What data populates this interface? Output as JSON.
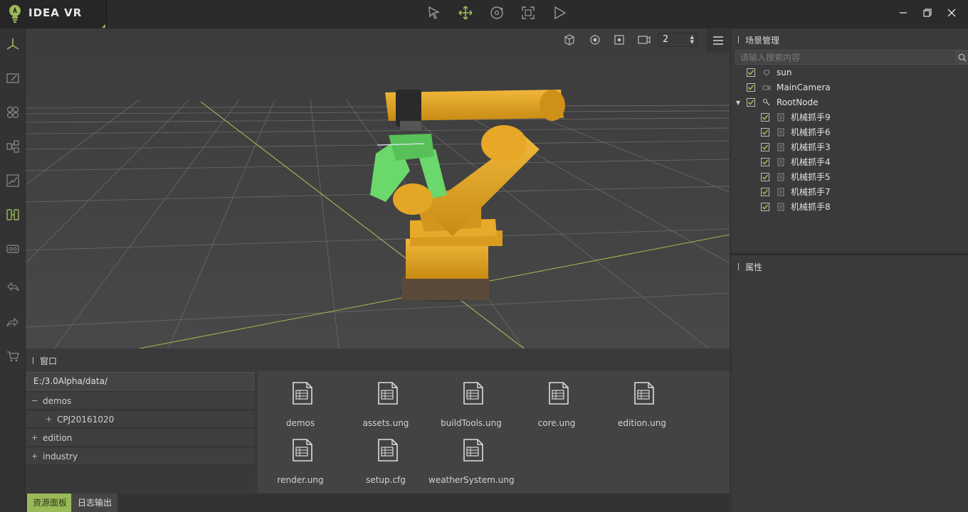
{
  "app": {
    "title": "IDEA VR"
  },
  "viewport": {
    "camera_index": "2"
  },
  "scene": {
    "title": "场景管理",
    "search_placeholder": "请输入搜索内容",
    "nodes": [
      {
        "label": "sun",
        "checked": true,
        "icon": "light-icon"
      },
      {
        "label": "MainCamera",
        "checked": true,
        "icon": "camera-icon"
      },
      {
        "label": "RootNode",
        "checked": true,
        "icon": "node-icon",
        "expanded": true
      },
      {
        "label": "机械抓手9",
        "checked": true,
        "icon": "mesh-icon"
      },
      {
        "label": "机械抓手6",
        "checked": true,
        "icon": "mesh-icon"
      },
      {
        "label": "机械抓手3",
        "checked": true,
        "icon": "mesh-icon"
      },
      {
        "label": "机械抓手4",
        "checked": true,
        "icon": "mesh-icon"
      },
      {
        "label": "机械抓手5",
        "checked": true,
        "icon": "mesh-icon"
      },
      {
        "label": "机械抓手7",
        "checked": true,
        "icon": "mesh-icon"
      },
      {
        "label": "机械抓手8",
        "checked": true,
        "icon": "mesh-icon"
      }
    ]
  },
  "properties": {
    "title": "属性"
  },
  "window": {
    "title": "窗口",
    "path": "E:/3.0Alpha/data/",
    "tree": [
      {
        "label": "demos",
        "sign": "−"
      },
      {
        "label": "CPJ20161020",
        "sign": "+"
      },
      {
        "label": "edition",
        "sign": "+"
      },
      {
        "label": "industry",
        "sign": "+"
      }
    ],
    "files": [
      "demos",
      "assets.ung",
      "buildTools.ung",
      "core.ung",
      "edition.ung",
      "render.ung",
      "setup.cfg",
      "weatherSystem.ung"
    ]
  },
  "tabs": {
    "resources": "资源面板",
    "log": "日志输出"
  },
  "colors": {
    "accent": "#9aba5a",
    "robot": "#e8a82a",
    "gripper": "#6ad86a"
  }
}
